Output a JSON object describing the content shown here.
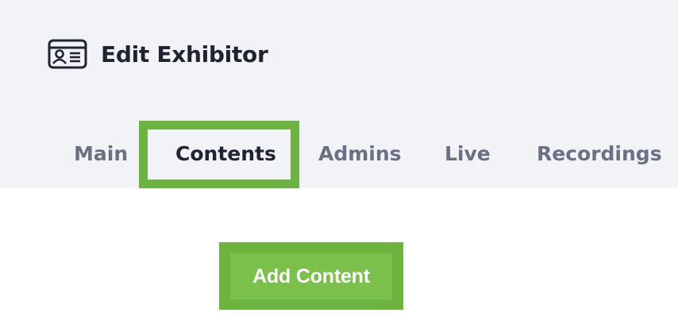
{
  "header": {
    "title": "Edit Exhibitor",
    "icon": "id-card-icon"
  },
  "tabs": [
    {
      "label": "Main",
      "active": false
    },
    {
      "label": "Contents",
      "active": true
    },
    {
      "label": "Admins",
      "active": false
    },
    {
      "label": "Live",
      "active": false
    },
    {
      "label": "Recordings",
      "active": false
    }
  ],
  "content": {
    "add_button_label": "Add Content"
  },
  "colors": {
    "highlight": "#6db33f",
    "button": "#7bc04b",
    "header_bg": "#f2f3f7",
    "active_text": "#1f2430",
    "inactive_text": "#6b7183"
  }
}
